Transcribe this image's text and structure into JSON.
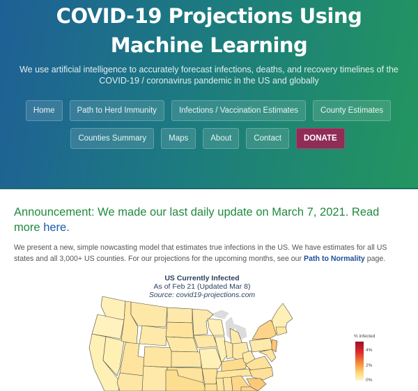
{
  "hero": {
    "title_line1": "COVID-19 Projections Using",
    "title_line2": "Machine Learning",
    "subtitle_line1": "We use artificial intelligence to accurately forecast infections, deaths, and recovery timelines of the",
    "subtitle_line2": "COVID-19 / coronavirus pandemic in the US and globally",
    "gradient_colors": [
      "#1e6096",
      "#1c7a80",
      "#23965f"
    ]
  },
  "nav": {
    "row1": [
      {
        "label": "Home"
      },
      {
        "label": "Path to Herd Immunity"
      },
      {
        "label": "Infections / Vaccination Estimates"
      },
      {
        "label": "County Estimates"
      }
    ],
    "row2": [
      {
        "label": "Counties Summary"
      },
      {
        "label": "Maps"
      },
      {
        "label": "About"
      },
      {
        "label": "Contact"
      },
      {
        "label": "DONATE"
      }
    ],
    "donate_color": "#8f2d56"
  },
  "announcement": {
    "text": "Announcement: We made our last daily update on March 7, 2021. Read more ",
    "link": "here.",
    "color": "#1f8a3e",
    "link_color": "#1d5aa8"
  },
  "intro": {
    "text": "We present a new, simple nowcasting model that estimates true infections in the US. We have estimates for all US states and all 3,000+ US counties. For our projections for the upcoming months, see our ",
    "link": "Path to Normality",
    "suffix": " page."
  },
  "map": {
    "title": "US Currently Infected",
    "subtitle": "As of Feb 21 (Updated Mar 8)",
    "source": "Source: covid19-projections.com",
    "legend": {
      "title": "% infected",
      "ticks": [
        "4%",
        "2%",
        "0%"
      ],
      "colorscale": [
        "#fff6c8",
        "#fdd87a",
        "#f58a3a",
        "#d8272a",
        "#9e1028"
      ]
    }
  }
}
